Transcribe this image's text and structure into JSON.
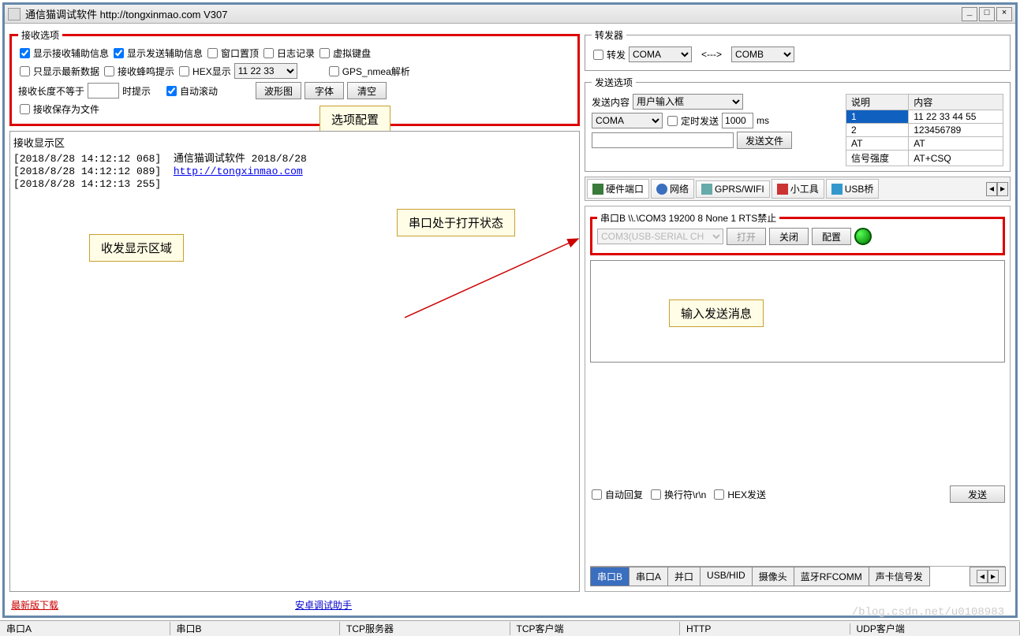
{
  "window": {
    "title": "通信猫调试软件  http://tongxinmao.com  V307"
  },
  "recv_opts": {
    "legend": "接收选项",
    "cb_show_recv_aux": "显示接收辅助信息",
    "cb_show_send_aux": "显示发送辅助信息",
    "cb_topmost": "窗口置顶",
    "cb_log": "日志记录",
    "cb_vkeyboard": "虚拟键盘",
    "cb_only_latest": "只显示最新数据",
    "cb_beep": "接收蜂鸣提示",
    "cb_hex_display": "HEX显示",
    "hex_value": "11 22 33",
    "cb_gps": "GPS_nmea解析",
    "len_label1": "接收长度不等于",
    "len_value": "",
    "len_label2": "时提示",
    "cb_autoscroll": "自动滚动",
    "btn_wave": "波形图",
    "btn_font": "字体",
    "btn_clear": "清空",
    "cb_save_file": "接收保存为文件"
  },
  "callouts": {
    "options": "选项配置",
    "display": "收发显示区域",
    "serial_open": "串口处于打开状态",
    "input_send": "输入发送消息"
  },
  "recv_area": {
    "title": "接收显示区",
    "lines": [
      {
        "ts": "[2018/8/28 14:12:12 068]",
        "text": "通信猫调试软件   2018/8/28"
      },
      {
        "ts": "[2018/8/28 14:12:12 089]",
        "link": "http://tongxinmao.com"
      },
      {
        "ts": "[2018/8/28 14:12:13 255]",
        "text": ""
      }
    ]
  },
  "forwarder": {
    "legend": "转发器",
    "cb_forward": "转发",
    "coma": "COMA",
    "arrow": "<--->",
    "comb": "COMB"
  },
  "send_opts": {
    "legend": "发送选项",
    "content_label": "发送内容",
    "content_select": "用户输入框",
    "port_select": "COMA",
    "cb_timed": "定时发送",
    "timed_value": "1000",
    "timed_unit": "ms",
    "file_value": "",
    "btn_sendfile": "发送文件",
    "table_headers": [
      "说明",
      "内容"
    ],
    "table_rows": [
      [
        "1",
        "11 22 33 44 55"
      ],
      [
        "2",
        "123456789"
      ],
      [
        "AT",
        "AT"
      ],
      [
        "信号强度",
        "AT+CSQ"
      ]
    ]
  },
  "tabs_top": {
    "t1": "硬件端口",
    "t2": "网络",
    "t3": "GPRS/WIFI",
    "t4": "小工具",
    "t5": "USB桥"
  },
  "port": {
    "label": "串口B \\\\.\\COM3  19200  8  None  1  RTS禁止",
    "select": "COM3(USB-SERIAL CH",
    "btn_open": "打开",
    "btn_close": "关闭",
    "btn_config": "配置"
  },
  "send": {
    "cb_auto_reply": "自动回复",
    "cb_newline": "换行符\\r\\n",
    "cb_hex_send": "HEX发送",
    "btn_send": "发送"
  },
  "tabs_bottom": {
    "t1": "串口B",
    "t2": "串口A",
    "t3": "并口",
    "t4": "USB/HID",
    "t5": "摄像头",
    "t6": "蓝牙RFCOMM",
    "t7": "声卡信号发"
  },
  "footer": {
    "latest": "最新版下载",
    "android": "安卓调试助手"
  },
  "statusbar": {
    "s1": "串口A",
    "s2": "串口B",
    "s3": "TCP服务器",
    "s4": "TCP客户端",
    "s5": "HTTP",
    "s6": "UDP客户端"
  },
  "watermark": "/blog.csdn.net/u0108983"
}
